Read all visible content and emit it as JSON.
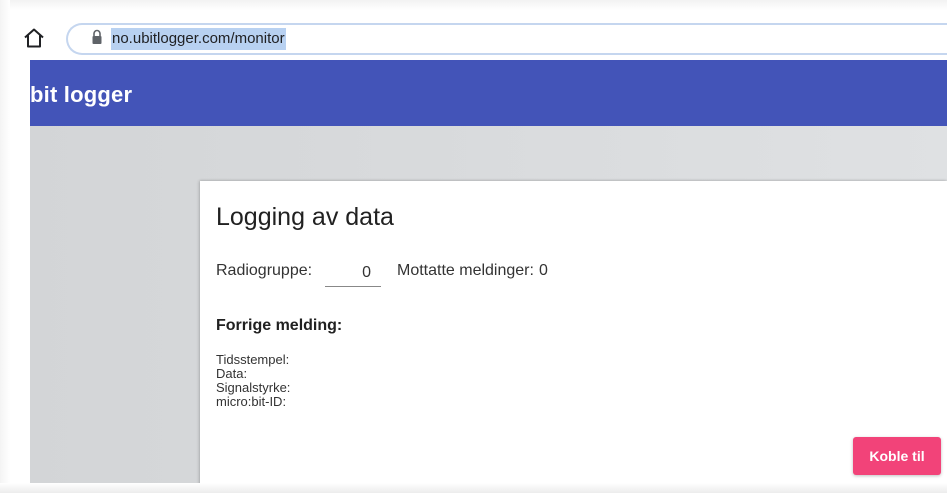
{
  "browser": {
    "url": "no.ubitlogger.com/monitor"
  },
  "app": {
    "title": "bit logger",
    "brand_color": "#4354b8"
  },
  "card": {
    "title": "Logging av data",
    "radio_group_label": "Radiogruppe:",
    "radio_group_value": "0",
    "received_label": "Mottatte meldinger:",
    "received_count": "0",
    "previous_heading": "Forrige melding:",
    "details": [
      {
        "label": "Tidsstempel:"
      },
      {
        "label": "Data:"
      },
      {
        "label": "Signalstyrke:"
      },
      {
        "label": "micro:bit-ID:"
      }
    ],
    "connect_button_label": "Koble til",
    "connect_button_color": "#f24379"
  },
  "icons": {
    "home": "home-icon",
    "lock": "lock-icon"
  }
}
